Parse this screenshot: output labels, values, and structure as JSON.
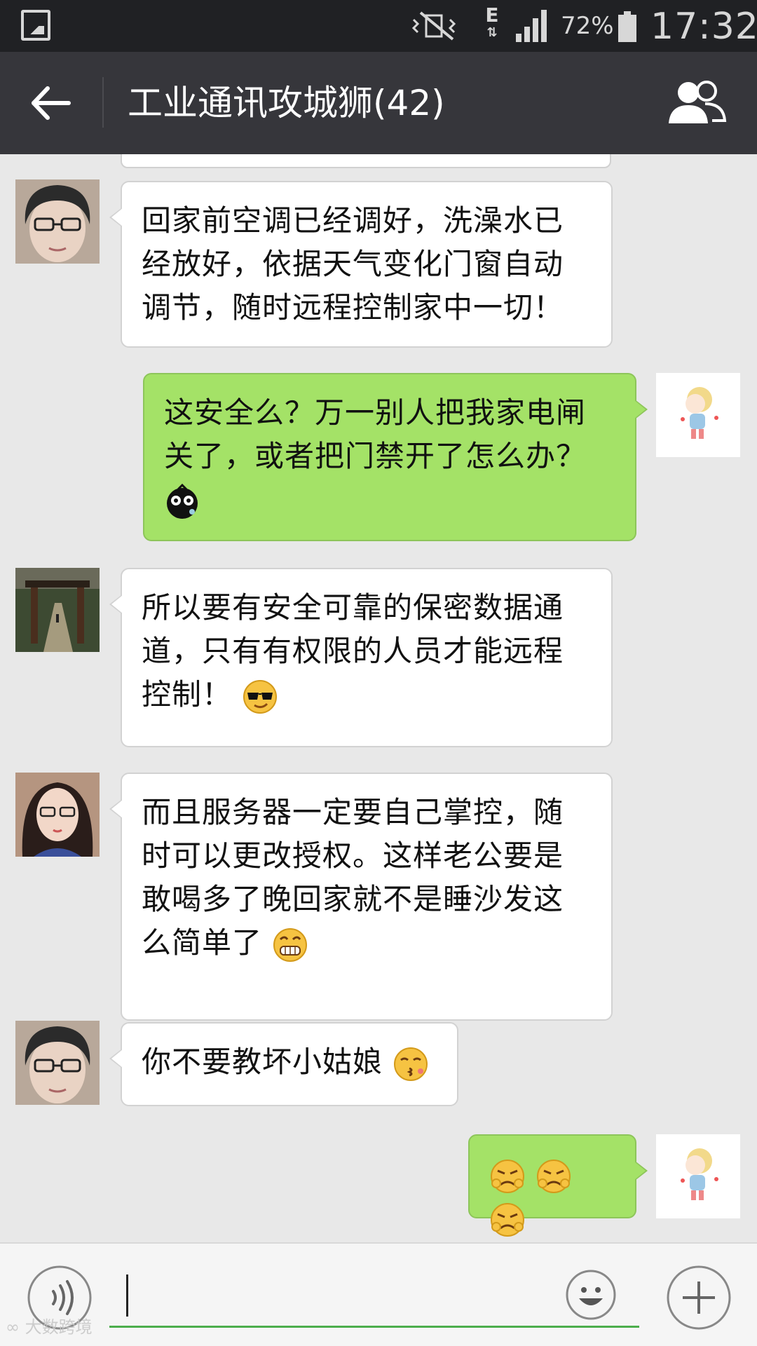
{
  "status_bar": {
    "network": "E",
    "battery": "72%",
    "time": "17:32"
  },
  "header": {
    "title": "工业通讯攻城狮(42)"
  },
  "messages": [
    {
      "side": "left",
      "avatar": "avatar-glasses-man",
      "text": "回家前空调已经调好，洗澡水已经放好，依据天气变化门窗自动调节，随时远程控制家中一切！"
    },
    {
      "side": "right",
      "avatar": "avatar-cartoon-girl",
      "text": "这安全么？万一别人把我家电闸关了，或者把门禁开了怎么办？",
      "emoji": "dizzy-face-emoji"
    },
    {
      "side": "left",
      "avatar": "avatar-park-gate",
      "text": "所以要有安全可靠的保密数据通道，只有有权限的人员才能远程控制！",
      "emoji": "cool-sunglasses-emoji"
    },
    {
      "side": "left",
      "avatar": "avatar-girl-glasses",
      "text": "而且服务器一定要自己掌控，随时可以更改授权。这样老公要是敢喝多了晚回家就不是睡沙发这么简单了",
      "emoji": "grinning-teeth-emoji"
    },
    {
      "side": "left",
      "avatar": "avatar-glasses-man",
      "text": "你不要教坏小姑娘",
      "emoji": "kissing-emoji"
    },
    {
      "side": "right",
      "avatar": "avatar-cartoon-girl",
      "text": "",
      "emoji": "sad-face-emoji x3"
    }
  ],
  "input": {
    "value": "",
    "placeholder": ""
  },
  "watermark": "大数跨境",
  "colors": {
    "chat_bg": "#e8e8e8",
    "title_bar": "#36363b",
    "status_bar": "#202124",
    "sent_bubble": "#a4e267",
    "received_bubble": "#ffffff",
    "input_underline": "#4cae4c"
  }
}
